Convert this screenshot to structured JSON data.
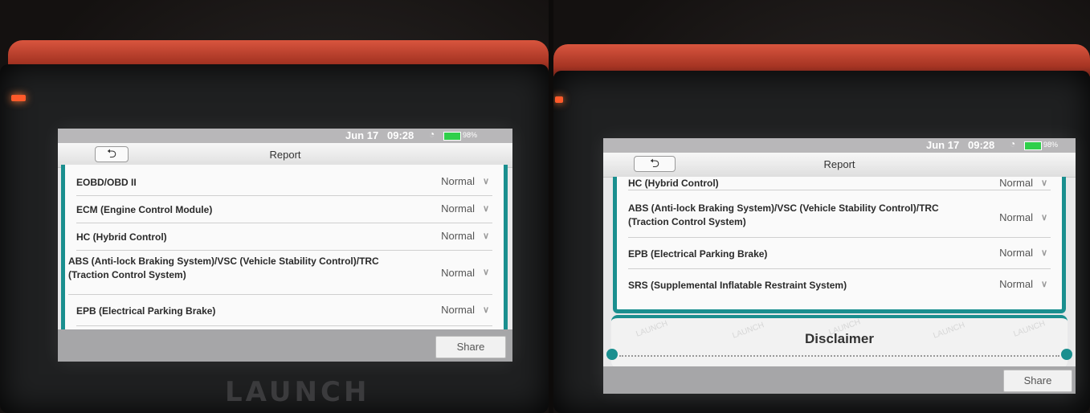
{
  "device": {
    "brand": "LAUNCH",
    "led_color": "#ff5a2a",
    "accent_color": "#1a8f8f"
  },
  "statusbar": {
    "date": "Jun 17",
    "time": "09:28",
    "battery": "98%",
    "wifi_icon": "wifi-icon",
    "battery_icon": "battery-icon"
  },
  "report": {
    "back_icon": "back-arrow-icon",
    "title": "Report",
    "share_label": "Share"
  },
  "left_rows": [
    {
      "name": "EOBD/OBD II",
      "status": "Normal"
    },
    {
      "name": "ECM (Engine Control Module)",
      "status": "Normal"
    },
    {
      "name": "HC (Hybrid Control)",
      "status": "Normal"
    },
    {
      "name": "ABS (Anti-lock Braking System)/VSC (Vehicle Stability Control)/TRC (Traction Control System)",
      "status": "Normal"
    },
    {
      "name": "EPB (Electrical Parking Brake)",
      "status": "Normal"
    }
  ],
  "right_rows": [
    {
      "name": "HC (Hybrid Control)",
      "status": "Normal"
    },
    {
      "name": "ABS (Anti-lock Braking System)/VSC (Vehicle Stability Control)/TRC (Traction Control System)",
      "status": "Normal"
    },
    {
      "name": "EPB (Electrical Parking Brake)",
      "status": "Normal"
    },
    {
      "name": "SRS (Supplemental Inflatable Restraint System)",
      "status": "Normal"
    }
  ],
  "disclaimer": {
    "title": "Disclaimer",
    "watermark": "LAUNCH"
  }
}
